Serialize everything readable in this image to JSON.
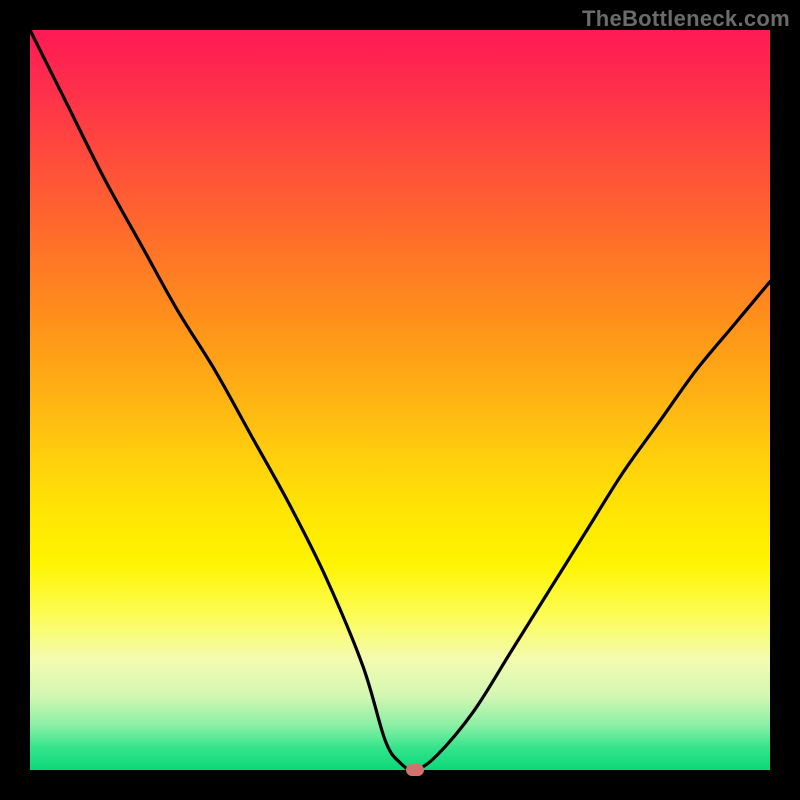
{
  "branding": "TheBottleneck.com",
  "chart_data": {
    "type": "line",
    "title": "",
    "xlabel": "",
    "ylabel": "",
    "xlim": [
      0,
      100
    ],
    "ylim": [
      0,
      100
    ],
    "x": [
      0,
      5,
      10,
      15,
      20,
      25,
      30,
      35,
      40,
      45,
      48,
      50,
      52,
      55,
      60,
      65,
      70,
      75,
      80,
      85,
      90,
      95,
      100
    ],
    "values": [
      100,
      90,
      80,
      71,
      62,
      54,
      45,
      36,
      26,
      14,
      4,
      1,
      0,
      2,
      8,
      16,
      24,
      32,
      40,
      47,
      54,
      60,
      66
    ],
    "marker": {
      "x": 52,
      "y": 0
    },
    "grid": false
  }
}
